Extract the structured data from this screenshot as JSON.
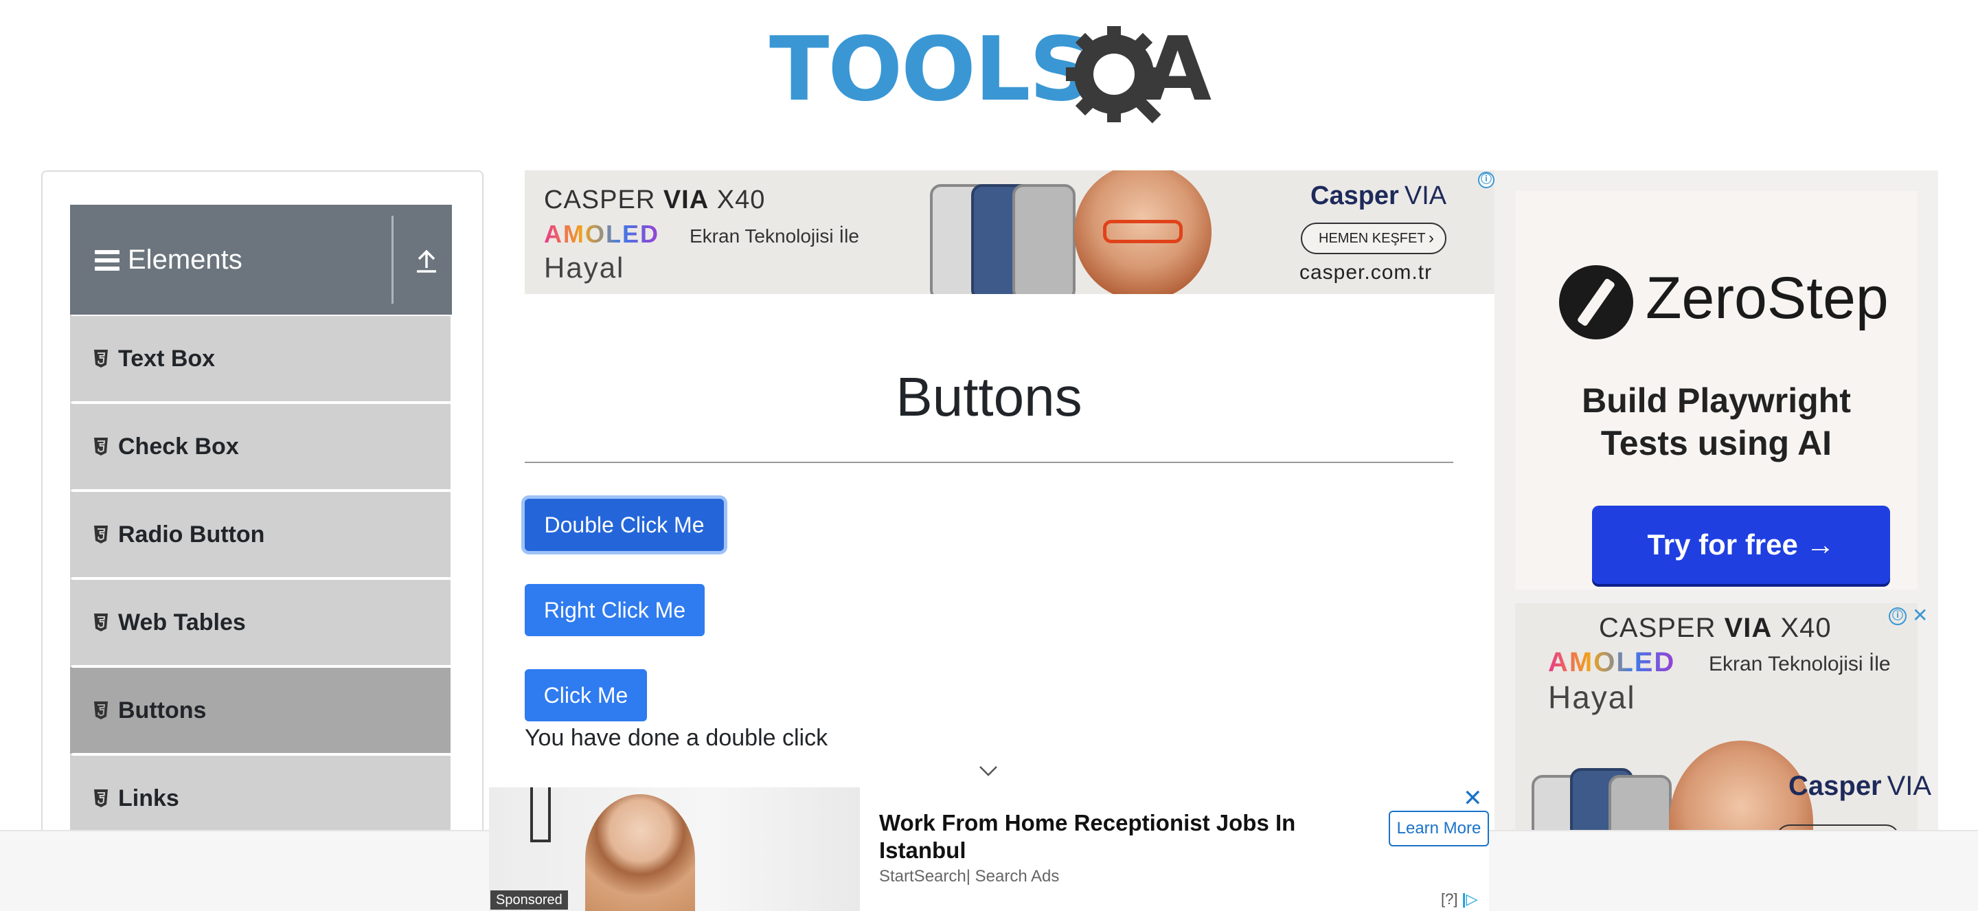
{
  "header": {
    "logo_text": "TOOLS",
    "logo_suffix": "A",
    "logo_colors": {
      "tools": "#3a97d4",
      "qa": "#3a3a3a"
    }
  },
  "sidebar": {
    "group_title": "Elements",
    "items": [
      {
        "label": "Text Box",
        "active": false
      },
      {
        "label": "Check Box",
        "active": false
      },
      {
        "label": "Radio Button",
        "active": false
      },
      {
        "label": "Web Tables",
        "active": false
      },
      {
        "label": "Buttons",
        "active": true
      },
      {
        "label": "Links",
        "active": false
      }
    ]
  },
  "top_ad": {
    "title_prefix": "CASPER ",
    "title_bold": "VIA",
    "title_suffix": " X40",
    "amoled": "AMOLED",
    "ekran": "Ekran Teknolojisi İle",
    "hayal": "Hayal",
    "brand": "Casper",
    "brand_suffix": "VIA",
    "cta": "HEMEN KEŞFET",
    "site": "casper.com.tr",
    "info_icon": "ⓘ"
  },
  "main": {
    "title": "Buttons",
    "double_click_label": "Double Click Me",
    "right_click_label": "Right Click Me",
    "click_label": "Click Me",
    "result_text": "You have done a double click"
  },
  "side_ad": {
    "zs_name": "ZeroStep",
    "zs_tagline_line1": "Build Playwright",
    "zs_tagline_line2": "Tests using AI",
    "zs_cta": "Try for free →",
    "c2_title_prefix": "CASPER ",
    "c2_title_bold": "VIA",
    "c2_title_suffix": " X40",
    "c2_amoled": "AMOLED",
    "c2_ekran": "Ekran Teknolojisi İle",
    "c2_hayal": "Hayal",
    "c2_brand": "Casper",
    "c2_brand_suffix": "VIA",
    "info_icon": "ⓘ",
    "close_icon": "✕"
  },
  "bottom_ad": {
    "sponsored": "Sponsored",
    "headline": "Work From Home Receptionist Jobs In Istanbul",
    "source": "StartSearch| Search Ads",
    "learn_more": "Learn More",
    "close": "✕",
    "adchoices": "[?]",
    "adchoices_mark": "|▷"
  },
  "colors": {
    "sidebar_header": "#6c757d",
    "menu_item": "#d0d0d0",
    "menu_item_active": "#a8a8a8",
    "button_primary": "#2f7bf0",
    "zerostep_cta": "#1f3fe0"
  }
}
